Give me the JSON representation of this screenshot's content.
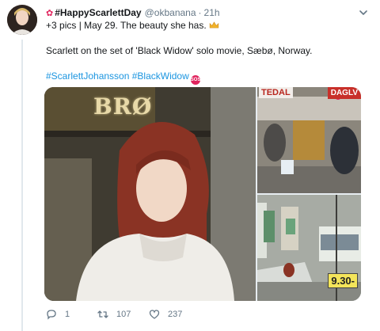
{
  "tweet": {
    "author": {
      "flower_icon": "cherry-blossom-icon",
      "display_name": "#HappyScarlettDay",
      "handle": "@okbanana",
      "separator": "·",
      "time": "21h"
    },
    "line1": "+3 pics | May 29. The beauty she has.",
    "line1_emoji": "crown-icon",
    "body": "Scarlett on the set of 'Black Widow' solo movie, Sæbø, Norway.",
    "hashtags": [
      "#ScarlettJohansson",
      "#BlackWidow"
    ],
    "hashtag_emoji": "sos-icon",
    "media": {
      "main_sign": "BRØ",
      "top_right_sign_left": "TEDAL",
      "top_right_sign_right": "DAGLV",
      "bottom_right_price": "9.30-"
    },
    "actions": {
      "reply_count": "1",
      "retweet_count": "107",
      "like_count": "237"
    }
  },
  "colors": {
    "link": "#1b95e0",
    "muted": "#657786",
    "text": "#14171a"
  }
}
